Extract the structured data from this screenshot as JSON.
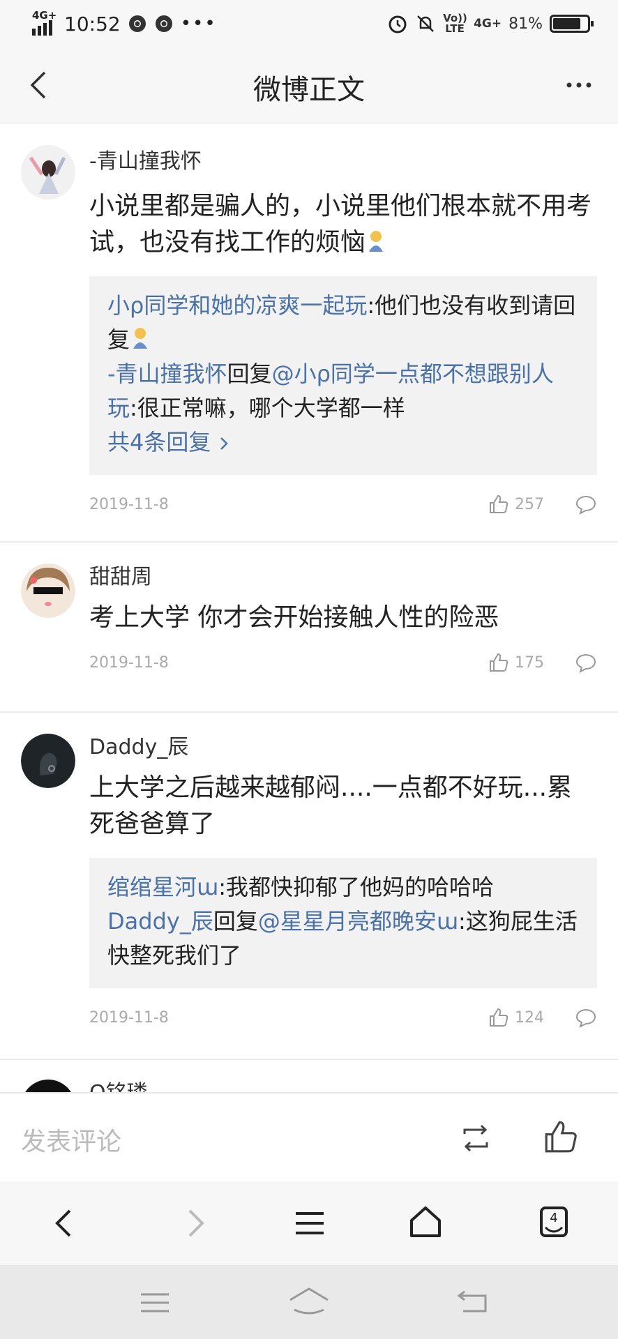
{
  "status": {
    "network": "4G+",
    "time": "10:52",
    "volte": "Vo)) LTE",
    "net2": "4G+",
    "battery_percent": "81%",
    "battery_level": 0.81
  },
  "header": {
    "title": "微博正文"
  },
  "comments": [
    {
      "username": "-青山撞我怀",
      "text": "小说里都是骗人的，小说里他们根本就不用考试，也没有找工作的烦恼",
      "replies": [
        {
          "from": "小ρ同学和她的凉爽一起玩",
          "to": "",
          "text": ":他们也没有收到请回复"
        },
        {
          "from": "-青山撞我怀",
          "to": "@小ρ同学一点都不想跟别人玩",
          "text": ":很正常嘛，哪个大学都一样"
        }
      ],
      "more_replies": "共4条回复",
      "date": "2019-11-8",
      "likes": "257"
    },
    {
      "username": "甜甜周",
      "text": "考上大学 你才会开始接触人性的险恶",
      "date": "2019-11-8",
      "likes": "175"
    },
    {
      "username": "Daddy_辰",
      "text": "上大学之后越来越郁闷....一点都不好玩...累死爸爸算了",
      "replies": [
        {
          "from": "绾绾星河ɯ",
          "to": "",
          "text": ":我都快抑郁了他妈的哈哈哈"
        },
        {
          "from": "Daddy_辰",
          "to": "@星星月亮都晚安ɯ",
          "text": ":这狗屁生活快整死我们了"
        }
      ],
      "date": "2019-11-8",
      "likes": "124"
    },
    {
      "username": "Q铭璘"
    }
  ],
  "reply_word": "回复",
  "bottom": {
    "comment_placeholder": "发表评论"
  },
  "browser_nav": {
    "tab_count": "4"
  }
}
